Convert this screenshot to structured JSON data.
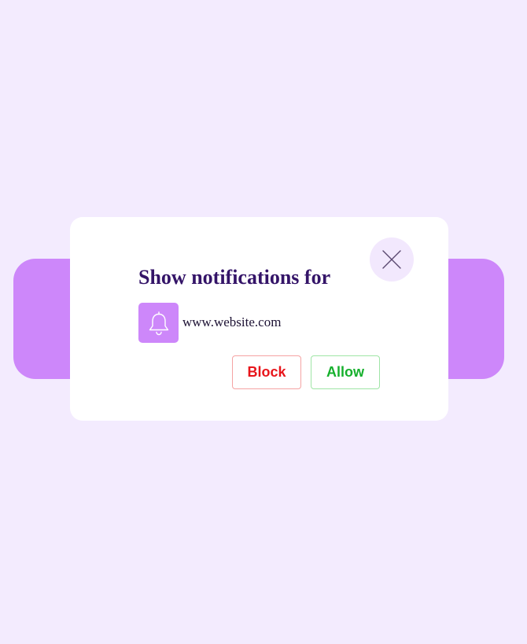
{
  "dialog": {
    "title": "Show notifications for",
    "site": "www.website.com",
    "block_label": "Block",
    "allow_label": "Allow",
    "close_icon": "close-icon",
    "bell_icon": "bell-icon"
  },
  "colors": {
    "background": "#f3ebfe",
    "accent": "#cd87fa",
    "title": "#341468",
    "block": "#e8151b",
    "allow": "#16b02d"
  }
}
